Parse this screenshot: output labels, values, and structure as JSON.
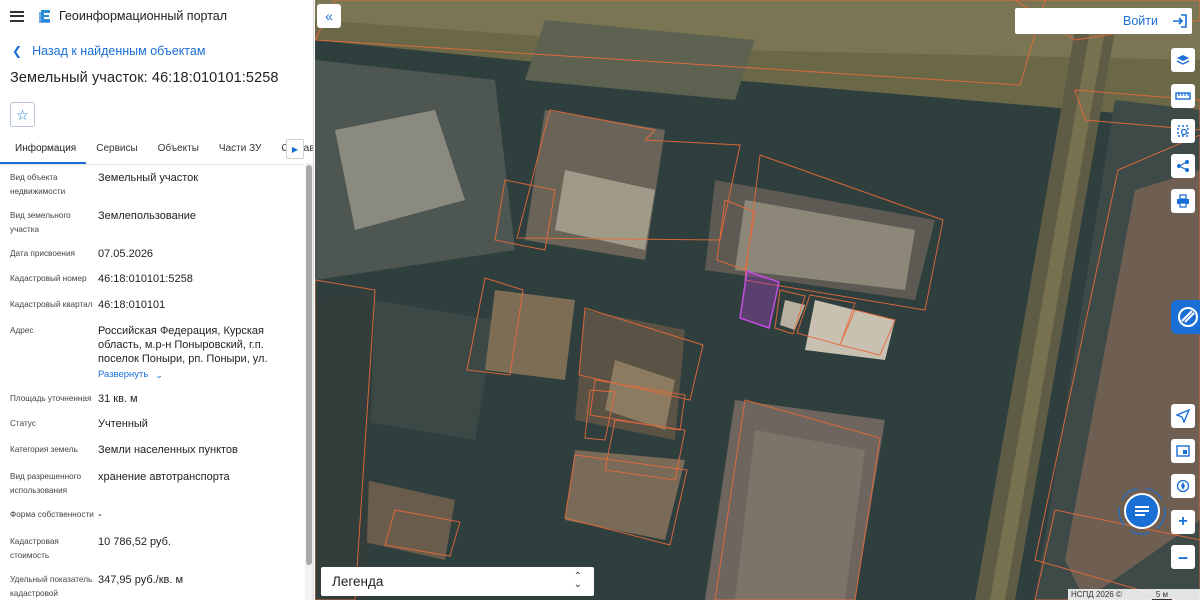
{
  "app": {
    "title": "Геоинформационный портал"
  },
  "back": {
    "label": "Назад к найденным объектам"
  },
  "object": {
    "title": "Земельный участок: 46:18:010101:5258"
  },
  "tabs": [
    "Информация",
    "Сервисы",
    "Объекты",
    "Части ЗУ",
    "Состав"
  ],
  "properties": [
    {
      "label": "Вид объекта недвижимости",
      "value": "Земельный участок"
    },
    {
      "label": "Вид земельного участка",
      "value": "Землепользование"
    },
    {
      "label": "Дата присвоения",
      "value": "07.05.2026"
    },
    {
      "label": "Кадастровый номер",
      "value": "46:18:010101:5258"
    },
    {
      "label": "Кадастровый квартал",
      "value": "46:18:010101"
    },
    {
      "label": "Адрес",
      "value": "Российская Федерация, Курская область, м.р-н Поныровский, г.п. поселок Поныри, рп. Поныри, ул.",
      "expand": "Развернуть"
    },
    {
      "label": "Площадь уточненная",
      "value": "31 кв. м"
    },
    {
      "label": "Статус",
      "value": "Учтенный"
    },
    {
      "label": "Категория земель",
      "value": "Земли населенных пунктов"
    },
    {
      "label": "Вид разрешенного использования",
      "value": "хранение автотранспорта"
    },
    {
      "label": "Форма собственности",
      "value": "-"
    },
    {
      "label": "Кадастровая стоимость",
      "value": "10 786,52 руб."
    },
    {
      "label": "Удельный показатель кадастровой",
      "value": "347,95 руб./кв. м"
    }
  ],
  "map": {
    "login_label": "Войти",
    "legend_label": "Легенда",
    "attribution": "НСПД 2026 ©",
    "scale_label": "5 м",
    "tools": [
      "layers-icon",
      "ruler-icon",
      "select-area-icon",
      "share-icon",
      "print-icon",
      "geolocation-icon",
      "minimap-icon",
      "compass-icon",
      "zoom-in-icon",
      "zoom-out-icon"
    ]
  },
  "colors": {
    "accent": "#1a6fd6",
    "parcel_border": "#e86a3a",
    "selected_parcel": "#b040c8"
  }
}
